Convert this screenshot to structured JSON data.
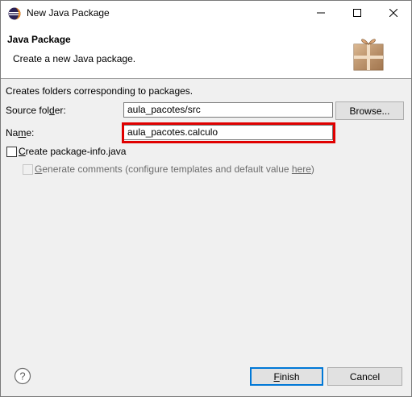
{
  "window": {
    "title": "New Java Package",
    "icon": "eclipse-icon"
  },
  "header": {
    "title": "Java Package",
    "description": "Create a new Java package.",
    "icon": "package-icon"
  },
  "body": {
    "intro": "Creates folders corresponding to packages.",
    "source_folder": {
      "label_pre": "Source fol",
      "label_mnemonic": "d",
      "label_post": "er:",
      "value": "aula_pacotes/src",
      "browse_label": "Browse..."
    },
    "name": {
      "label_pre": "Na",
      "label_mnemonic": "m",
      "label_post": "e:",
      "value": "aula_pacotes.calculo"
    },
    "create_package_info": {
      "label_mnemonic": "C",
      "label_post": "reate package-info.java",
      "checked": false
    },
    "generate_comments": {
      "label_mnemonic": "G",
      "label_post": "enerate comments",
      "suffix": "(configure templates and default value ",
      "link": "here",
      "end": ")",
      "enabled": false,
      "checked": false
    }
  },
  "footer": {
    "finish_mnemonic": "F",
    "finish_post": "inish",
    "cancel_label": "Cancel",
    "help_icon": "help-icon"
  },
  "colors": {
    "highlight": "#e00000",
    "default_button_border": "#0078d7"
  }
}
